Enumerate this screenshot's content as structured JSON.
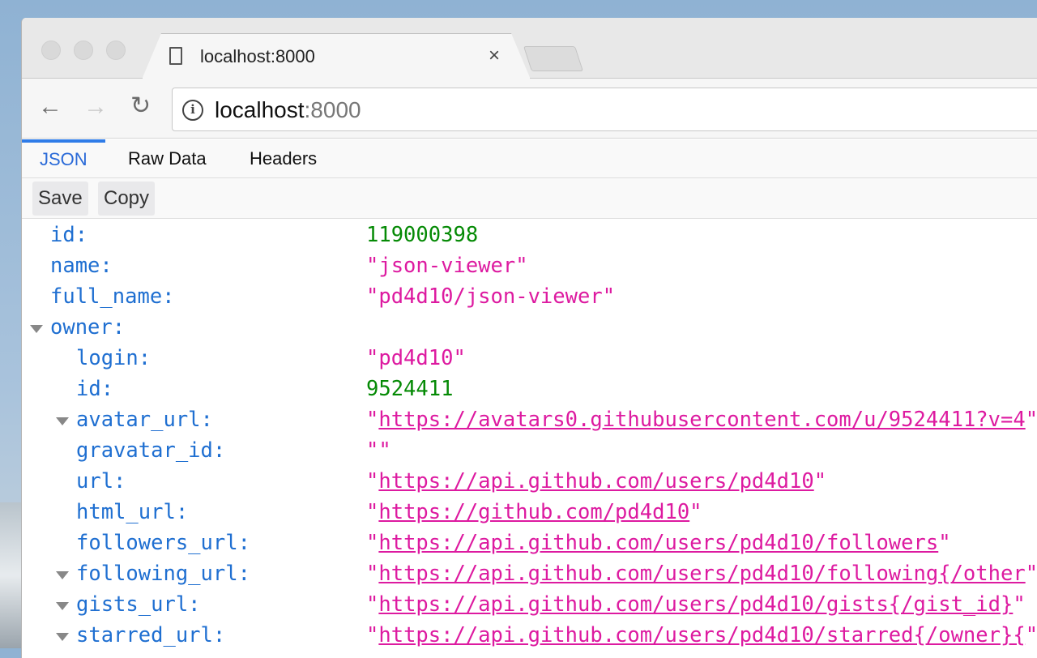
{
  "tab": {
    "title": "localhost:8000",
    "close": "×"
  },
  "address": {
    "host": "localhost",
    "port": ":8000"
  },
  "nav": {
    "back": "←",
    "forward": "→",
    "reload": "↻"
  },
  "viewer_tabs": [
    {
      "label": "JSON",
      "active": true
    },
    {
      "label": "Raw Data"
    },
    {
      "label": "Headers"
    }
  ],
  "buttons": {
    "save": "Save",
    "copy": "Copy"
  },
  "colors": {
    "key": "#1f6fd1",
    "number": "#058a05",
    "string": "#dd1aa0",
    "active_tab": "#2f7ce8"
  },
  "rows": [
    {
      "key": "id:",
      "value": "119000398",
      "type": "number",
      "depth": 0
    },
    {
      "key": "name:",
      "value": "\"json-viewer\"",
      "type": "string",
      "depth": 0
    },
    {
      "key": "full_name:",
      "value": "\"pd4d10/json-viewer\"",
      "type": "string",
      "depth": 0
    },
    {
      "key": "owner:",
      "value": "",
      "type": "object",
      "depth": 0,
      "expanded": true
    },
    {
      "key": "login:",
      "value": "\"pd4d10\"",
      "type": "string",
      "depth": 1
    },
    {
      "key": "id:",
      "value": "9524411",
      "type": "number",
      "depth": 1
    },
    {
      "key": "avatar_url:",
      "value": "https://avatars0.githubusercontent.com/u/9524411?v=4",
      "type": "url",
      "depth": 1,
      "expanded": true
    },
    {
      "key": "gravatar_id:",
      "value": "\"\"",
      "type": "string",
      "depth": 1
    },
    {
      "key": "url:",
      "value": "https://api.github.com/users/pd4d10",
      "type": "url",
      "depth": 1
    },
    {
      "key": "html_url:",
      "value": "https://github.com/pd4d10",
      "type": "url",
      "depth": 1
    },
    {
      "key": "followers_url:",
      "value": "https://api.github.com/users/pd4d10/followers",
      "type": "url",
      "depth": 1
    },
    {
      "key": "following_url:",
      "value": "https://api.github.com/users/pd4d10/following{/other",
      "type": "url",
      "depth": 1,
      "expanded": true
    },
    {
      "key": "gists_url:",
      "value": "https://api.github.com/users/pd4d10/gists{/gist_id}",
      "type": "url",
      "depth": 1,
      "expanded": true
    },
    {
      "key": "starred_url:",
      "value": "https://api.github.com/users/pd4d10/starred{/owner}{",
      "type": "url",
      "depth": 1,
      "expanded": true
    }
  ]
}
